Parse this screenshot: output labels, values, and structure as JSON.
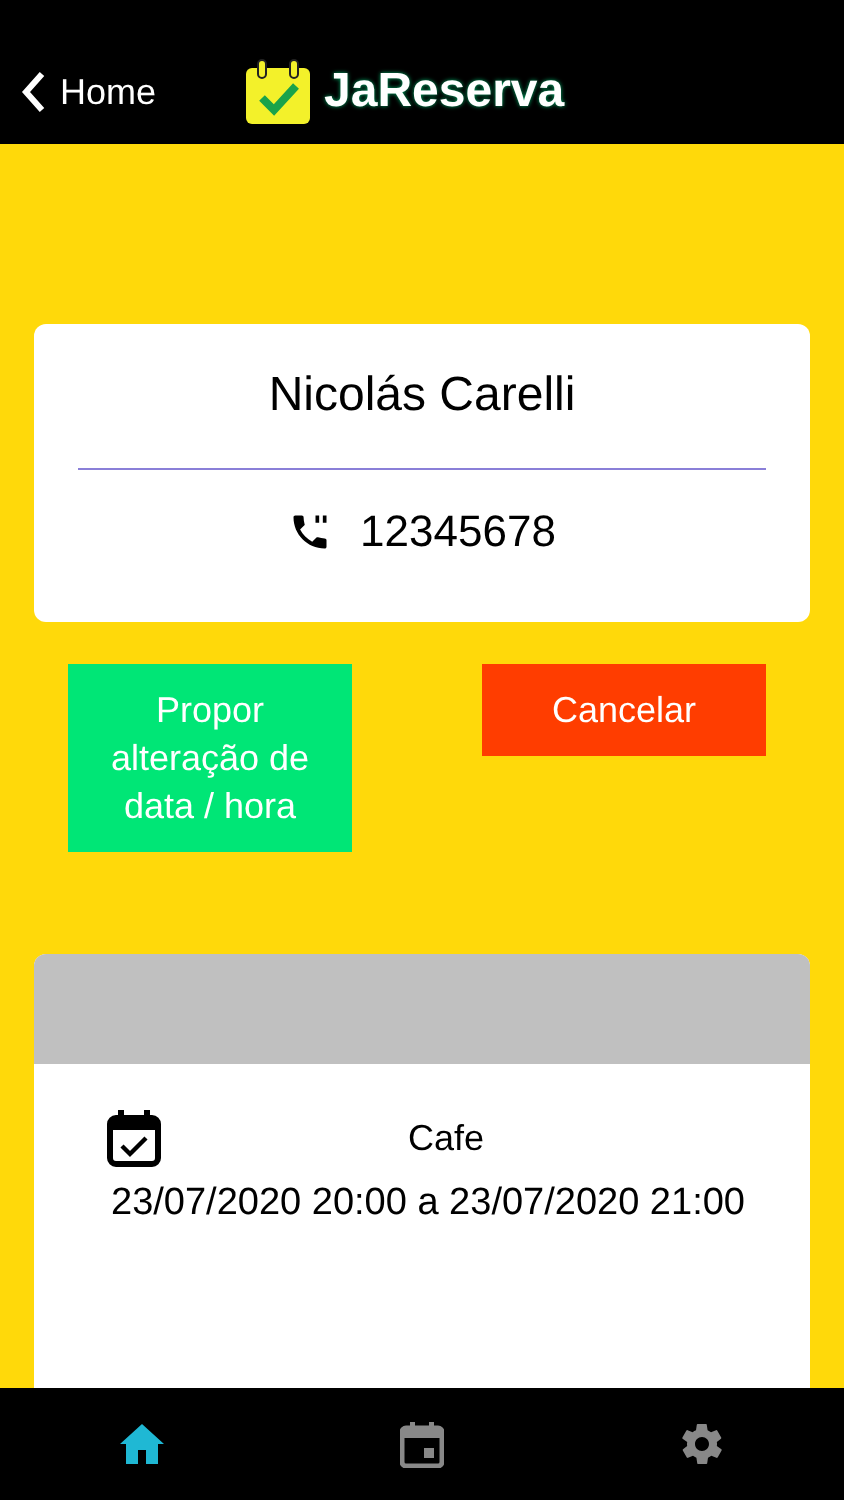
{
  "nav": {
    "back_label": "Home",
    "app_name": "JaReserva"
  },
  "contact": {
    "name": "Nicolás Carelli",
    "phone": "12345678"
  },
  "actions": [
    {
      "label": "Propor alteração de data / hora",
      "kind": "propose"
    },
    {
      "label": "Cancelar",
      "kind": "cancel"
    }
  ],
  "reservation": {
    "place": "Cafe",
    "period": "23/07/2020 20:00 a 23/07/2020 21:00"
  },
  "tab_bar": [
    {
      "kind": "home",
      "selected": true
    },
    {
      "kind": "calendar",
      "selected": false
    },
    {
      "kind": "settings",
      "selected": false
    }
  ]
}
